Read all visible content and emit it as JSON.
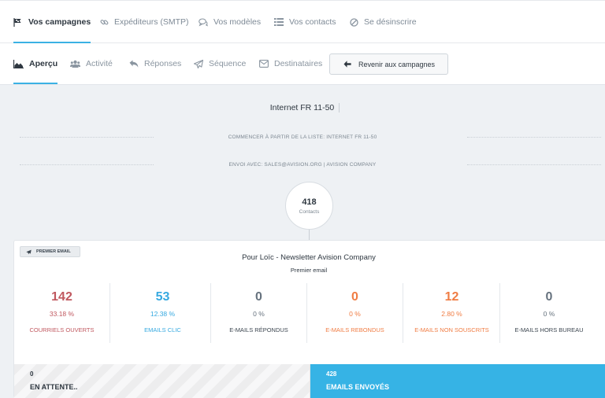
{
  "colors": {
    "accent": "#3bb1e4",
    "opened": "#c0585f",
    "clicks": "#36a9e0",
    "neutral": "#66727e",
    "orange": "#f07c43",
    "sent_bg": "#36b3e5"
  },
  "top_nav": [
    {
      "label": "Vos campagnes",
      "icon": "flag-icon",
      "active": true
    },
    {
      "label": "Expéditeurs (SMTP)",
      "icon": "link-icon"
    },
    {
      "label": "Vos modèles",
      "icon": "chat-bubble-icon"
    },
    {
      "label": "Vos contacts",
      "icon": "list-icon"
    },
    {
      "label": "Se désinscrire",
      "icon": "ban-icon"
    }
  ],
  "sub_nav": [
    {
      "label": "Aperçu",
      "icon": "area-chart-icon",
      "active": true
    },
    {
      "label": "Activité",
      "icon": "users-icon"
    },
    {
      "label": "Réponses",
      "icon": "reply-icon"
    },
    {
      "label": "Séquence",
      "icon": "paper-plane-icon"
    },
    {
      "label": "Destinataires",
      "icon": "envelope-icon"
    }
  ],
  "back_button": {
    "label": "Revenir aux campagnes",
    "icon": "arrow-left-icon"
  },
  "campaign": {
    "title": "Internet FR 11-50",
    "list_line": "COMMENCER À PARTIR DE LA LISTE: INTERNET FR 11-50",
    "sender_line": "ENVOI AVEC: SALES@AVISION.ORG | AVISION COMPANY",
    "contacts_count": "418",
    "contacts_label": "Contacts"
  },
  "email_card": {
    "badge": "PREMIER EMAIL",
    "badge_icon": "paper-plane-icon",
    "title": "Pour Loïc - Newsletter Avision Company",
    "subtitle": "Premier email",
    "stats": [
      {
        "value": "142",
        "percent": "33.18 %",
        "label": "COURRIELS OUVERTS",
        "color": "#c0585f",
        "label_color": "#c0585f"
      },
      {
        "value": "53",
        "percent": "12.38 %",
        "label": "EMAILS CLIC",
        "color": "#36a9e0",
        "label_color": "#36a9e0"
      },
      {
        "value": "0",
        "percent": "0 %",
        "label": "E-MAILS RÉPONDUS",
        "color": "#66727e",
        "label_color": "#3c4650"
      },
      {
        "value": "0",
        "percent": "0 %",
        "label": "E-MAILS REBONDUS",
        "color": "#f07c43",
        "label_color": "#f07c43"
      },
      {
        "value": "12",
        "percent": "2.80 %",
        "label": "E-MAILS NON SOUSCRITS",
        "color": "#f07c43",
        "label_color": "#f07c43"
      },
      {
        "value": "0",
        "percent": "0 %",
        "label": "E-MAILS HORS BUREAU",
        "color": "#66727e",
        "label_color": "#3c4650"
      }
    ],
    "pending": {
      "count": "0",
      "label": "EN ATTENTE.."
    },
    "sent": {
      "count": "428",
      "label": "EMAILS ENVOYÉS"
    }
  }
}
